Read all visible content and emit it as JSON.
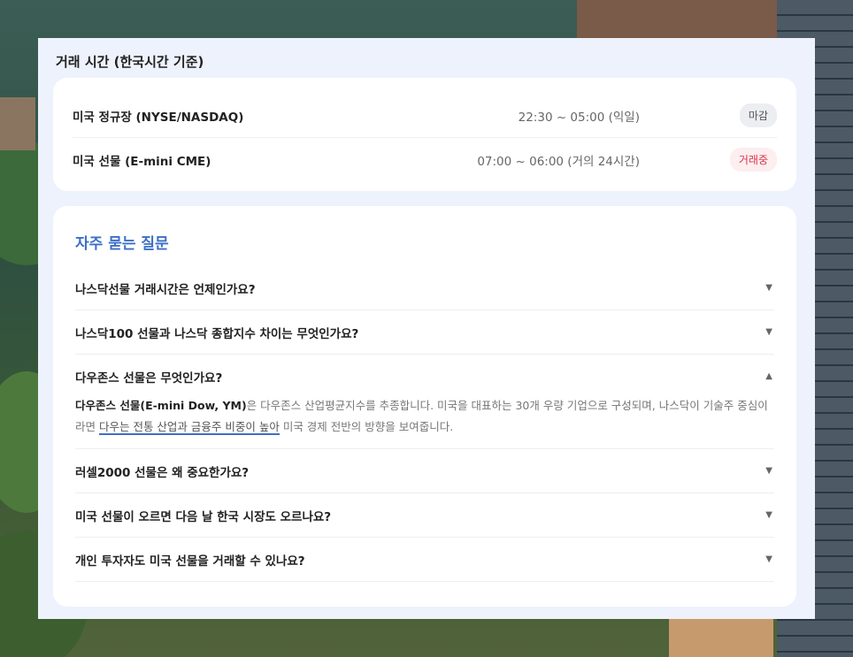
{
  "hours": {
    "title": "거래 시간 (한국시간 기준)",
    "rows": [
      {
        "market": "미국 정규장 (NYSE/NASDAQ)",
        "time": "22:30 ~ 05:00 (익일)",
        "status": "마감"
      },
      {
        "market": "미국 선물 (E-mini CME)",
        "time": "07:00 ~ 06:00 (거의 24시간)",
        "status": "거래중"
      }
    ]
  },
  "faq": {
    "title": "자주 묻는 질문",
    "items": [
      {
        "q": "나스닥선물 거래시간은 언제인가요?",
        "chev": "▼"
      },
      {
        "q": "나스닥100 선물과 나스닥 종합지수 차이는 무엇인가요?",
        "chev": "▼"
      },
      {
        "q": "다우존스 선물은 무엇인가요?",
        "chev": "▲",
        "answer": {
          "bold": "다우존스 선물(E-mini Dow, YM)",
          "part1": "은 다우존스 산업평균지수를 추종합니다. 미국을 대표하는 30개 우량 기업으로 구성되며, 나스닥이 기술주 중심이라면 ",
          "highlight": "다우는 전통 산업과 금융주 비중이 높아",
          "part2": " 미국 경제 전반의 방향을 보여줍니다."
        }
      },
      {
        "q": "러셀2000 선물은 왜 중요한가요?",
        "chev": "▼"
      },
      {
        "q": "미국 선물이 오르면 다음 날 한국 시장도 오르나요?",
        "chev": "▼"
      },
      {
        "q": "개인 투자자도 미국 선물을 거래할 수 있나요?",
        "chev": "▼"
      }
    ]
  }
}
